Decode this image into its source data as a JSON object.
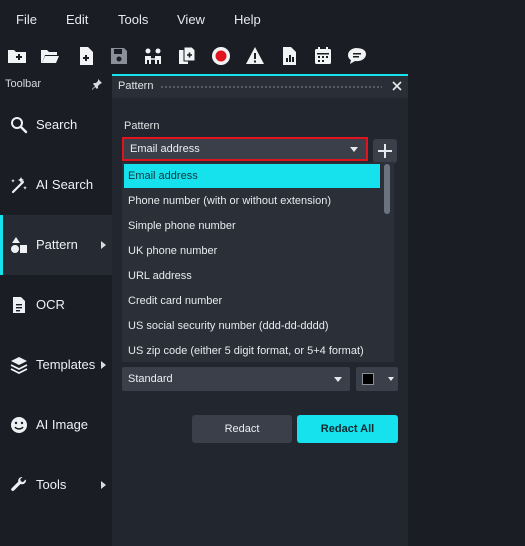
{
  "menu": [
    "File",
    "Edit",
    "Tools",
    "View",
    "Help"
  ],
  "toolbar_icons": [
    "new-file-plus-icon",
    "open-folder-icon",
    "add-document-icon",
    "save-icon",
    "collaborators-icon",
    "copy-file-icon",
    "record-icon",
    "warning-icon",
    "report-chart-icon",
    "calendar-icon",
    "chat-bubble-icon"
  ],
  "sidebar": {
    "title": "Toolbar",
    "items": [
      {
        "label": "Search",
        "icon": "search-icon"
      },
      {
        "label": "AI Search",
        "icon": "ai-search-icon"
      },
      {
        "label": "Pattern",
        "icon": "shapes-icon"
      },
      {
        "label": "OCR",
        "icon": "document-icon"
      },
      {
        "label": "Templates",
        "icon": "layers-icon"
      },
      {
        "label": "AI Image",
        "icon": "smiley-icon"
      },
      {
        "label": "Tools",
        "icon": "wrench-icon"
      }
    ]
  },
  "panel": {
    "title": "Pattern",
    "field_label": "Pattern",
    "selected_pattern": "Email address",
    "options": [
      "Email address",
      "Phone number (with or without extension)",
      "Simple phone number",
      "UK phone number",
      "URL address",
      "Credit card number",
      "US social security number (ddd-dd-dddd)",
      "US zip code (either 5 digit format, or 5+4 format)"
    ],
    "style_value": "Standard",
    "swatch_color": "#000000",
    "redact_label": "Redact",
    "redact_all_label": "Redact All"
  },
  "colors": {
    "accent": "#16e2ee",
    "highlight_border": "#e0141e"
  }
}
